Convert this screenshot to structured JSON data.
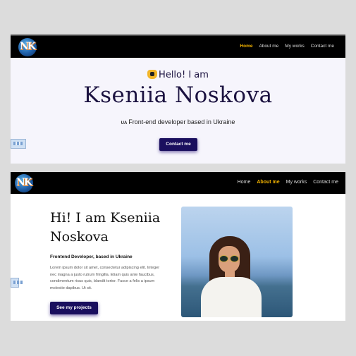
{
  "logo_text": "NK",
  "shot1": {
    "nav": [
      "Home",
      "About me",
      "My works",
      "Contact me"
    ],
    "hello": "Hello! I am",
    "name": "Kseniia Noskova",
    "ua": "UA",
    "subtitle": "Front-end developer based in Ukraine",
    "button": "Contact me"
  },
  "shot2": {
    "nav": [
      "Home",
      "About me",
      "My works",
      "Contact me"
    ],
    "heading_line1": "Hi! I am Kseniia",
    "heading_line2": "Noskova",
    "role": "Frontend Developer, based in Ukraine",
    "lorem": "Lorem ipsum dolor sit amet, consectetur adipiscing elit. Integer nec magna a justo rutrum fringilla. Etiam quis ante faucibus, condimentum risus quis, blandit tortor. Fusce a felis a ipsum molestie dapibus. Ut sit.",
    "button": "See my projects"
  },
  "colors": {
    "accent": "#f4b400",
    "button": "#1a0f5e",
    "nav_bg": "#000000"
  }
}
